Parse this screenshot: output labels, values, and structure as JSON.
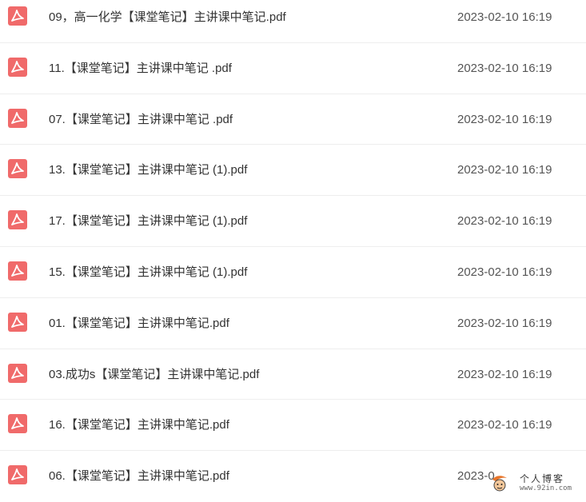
{
  "files": [
    {
      "name": "09，高一化学【课堂笔记】主讲课中笔记.pdf",
      "date": "2023-02-10 16:19",
      "icon": "pdf-icon"
    },
    {
      "name": "11.【课堂笔记】主讲课中笔记 .pdf",
      "date": "2023-02-10 16:19",
      "icon": "pdf-icon"
    },
    {
      "name": "07.【课堂笔记】主讲课中笔记 .pdf",
      "date": "2023-02-10 16:19",
      "icon": "pdf-icon"
    },
    {
      "name": "13.【课堂笔记】主讲课中笔记 (1).pdf",
      "date": "2023-02-10 16:19",
      "icon": "pdf-icon"
    },
    {
      "name": "17.【课堂笔记】主讲课中笔记 (1).pdf",
      "date": "2023-02-10 16:19",
      "icon": "pdf-icon"
    },
    {
      "name": "15.【课堂笔记】主讲课中笔记 (1).pdf",
      "date": "2023-02-10 16:19",
      "icon": "pdf-icon"
    },
    {
      "name": "01.【课堂笔记】主讲课中笔记.pdf",
      "date": "2023-02-10 16:19",
      "icon": "pdf-icon"
    },
    {
      "name": "03.成功s【课堂笔记】主讲课中笔记.pdf",
      "date": "2023-02-10 16:19",
      "icon": "pdf-icon"
    },
    {
      "name": "16.【课堂笔记】主讲课中笔记.pdf",
      "date": "2023-02-10 16:19",
      "icon": "pdf-icon"
    },
    {
      "name": "06.【课堂笔记】主讲课中笔记.pdf",
      "date": "2023-0",
      "icon": "pdf-icon"
    }
  ],
  "watermark": {
    "title": "个人博客",
    "url": "www.92in.com"
  },
  "colors": {
    "pdf_icon": "#f06a6a",
    "row_divider": "#eeeeee",
    "text": "#333333",
    "date_text": "#555555"
  }
}
